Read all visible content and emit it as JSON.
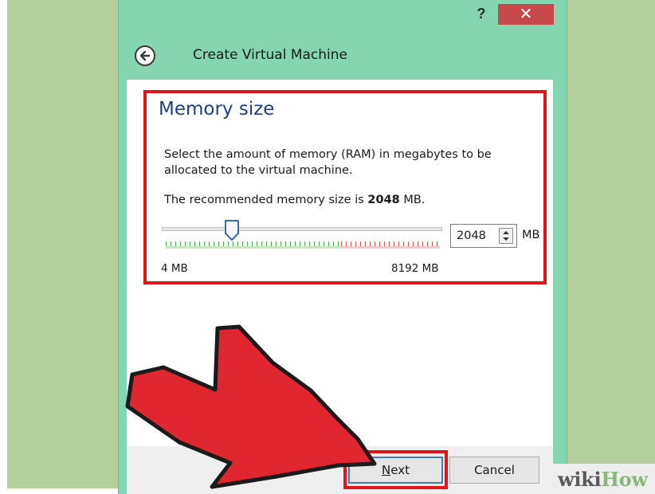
{
  "window": {
    "title": "Create Virtual Machine",
    "help_glyph": "?",
    "close_glyph": "✕"
  },
  "memory": {
    "section_title": "Memory size",
    "description": "Select the amount of memory (RAM) in megabytes to be allocated to the virtual machine.",
    "recommended_prefix": "The recommended memory size is",
    "recommended_value": "2048",
    "recommended_suffix": "MB.",
    "slider_min_label": "4 MB",
    "slider_max_label": "8192 MB",
    "slider_value_fraction": 0.25,
    "input_value": "2048",
    "unit": "MB"
  },
  "footer": {
    "next_label_underlined": "N",
    "next_label_rest": "ext",
    "cancel_label": "Cancel"
  },
  "watermark": {
    "wiki": "wiki",
    "how": "How"
  },
  "colors": {
    "window_frame": "#84d5b0",
    "highlight": "#e0141c",
    "arrow": "#e0262f",
    "title_blue": "#1f3d8a"
  }
}
